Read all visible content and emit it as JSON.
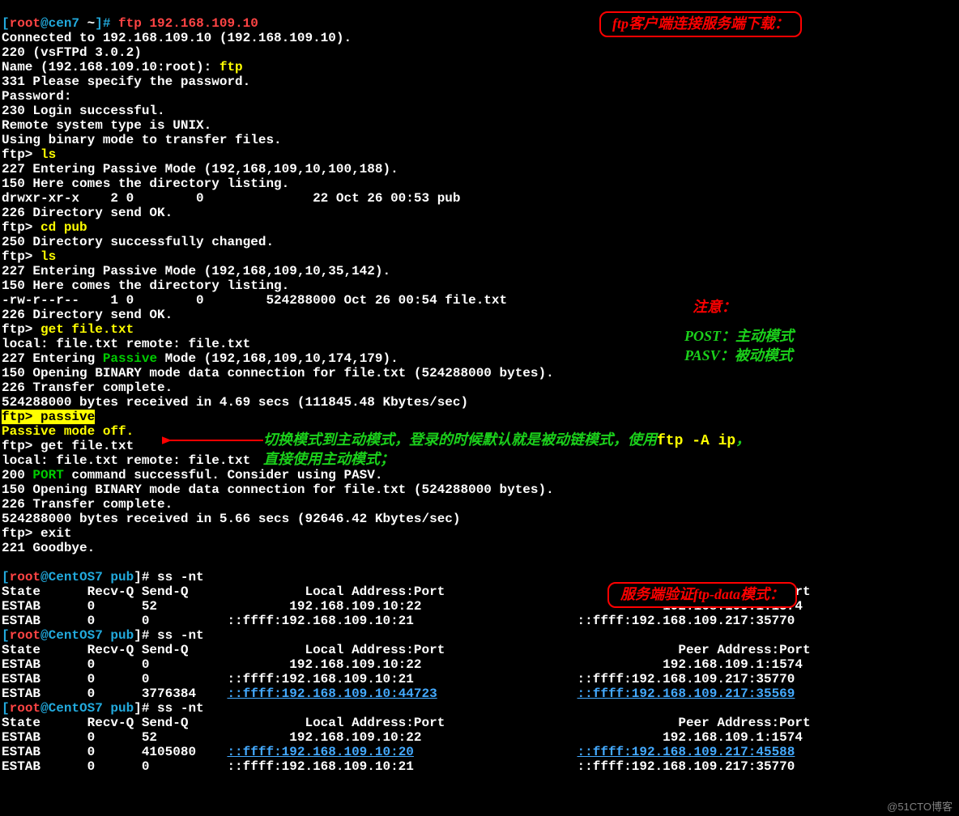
{
  "box1_text": "ftp客户端连接服务端下载：",
  "box2_text": "服务端验证ftp-data模式：",
  "warn_label": "注意：",
  "post_label": "POST：",
  "post_text": "主动模式",
  "pasv_label": "PASV：",
  "pasv_text": "被动模式",
  "mode_line1a": "切换模式到主动模式，登录的时候默认就是被动链模式，使用",
  "mode_line1b": "ftp -A ip",
  "mode_line1c": "，",
  "mode_line2": "直接使用主动模式；",
  "watermark": "@51CTO博客",
  "t": {
    "p1a": "[",
    "p1b": "root",
    "p1c": "@cen7 ",
    "p1d": "~",
    "p1e": "]# ",
    "p1f": "ftp 192.168.109.10",
    "l2": "Connected to 192.168.109.10 (192.168.109.10).",
    "l3": "220 (vsFTPd 3.0.2)",
    "l4a": "Name (192.168.109.10:root): ",
    "l4b": "ftp",
    "l5": "331 Please specify the password.",
    "l6": "Password:",
    "l7": "230 Login successful.",
    "l8": "Remote system type is UNIX.",
    "l9": "Using binary mode to transfer files.",
    "l10a": "ftp> ",
    "l10b": "ls",
    "l11": "227 Entering Passive Mode (192,168,109,10,100,188).",
    "l12": "150 Here comes the directory listing.",
    "l13": "drwxr-xr-x    2 0        0              22 Oct 26 00:53 pub",
    "l14": "226 Directory send OK.",
    "l15a": "ftp> ",
    "l15b": "cd pub",
    "l16": "250 Directory successfully changed.",
    "l17a": "ftp> ",
    "l17b": "ls",
    "l18": "227 Entering Passive Mode (192,168,109,10,35,142).",
    "l19": "150 Here comes the directory listing.",
    "l20": "-rw-r--r--    1 0        0        524288000 Oct 26 00:54 file.txt",
    "l21": "226 Directory send OK.",
    "l22a": "ftp> ",
    "l22b": "get file.txt",
    "l23": "local: file.txt remote: file.txt",
    "l24a": "227 Entering ",
    "l24b": "Passive",
    "l24c": " Mode (192,168,109,10,174,179).",
    "l25": "150 Opening BINARY mode data connection for file.txt (524288000 bytes).",
    "l26": "226 Transfer complete.",
    "l27": "524288000 bytes received in 4.69 secs (111845.48 Kbytes/sec)",
    "l28a": "ftp> ",
    "l28b": "passive",
    "l29": "Passive mode off.",
    "l30": "ftp> get file.txt",
    "l31": "local: file.txt remote: file.txt",
    "l32a": "200 ",
    "l32b": "PORT",
    "l32c": " command successful. Consider using PASV.",
    "l33": "150 Opening BINARY mode data connection for file.txt (524288000 bytes).",
    "l34": "226 Transfer complete.",
    "l35": "524288000 bytes received in 5.66 secs (92646.42 Kbytes/sec)",
    "l36": "ftp> exit",
    "l37": "221 Goodbye.",
    "blank": "",
    "p2a": "[",
    "p2b": "root",
    "p2c": "@CentOS7 pub",
    "p2d": "]# ss -nt",
    "hdr": "State      Recv-Q Send-Q               Local Address:Port                              Peer Address:Port",
    "r1": "ESTAB      0      52                 192.168.109.10:22                               192.168.109.1:1574",
    "r2": "ESTAB      0      0          ::ffff:192.168.109.10:21                     ::ffff:192.168.109.217:35770",
    "r3": "ESTAB      0      0                  192.168.109.10:22                               192.168.109.1:1574",
    "r4": "ESTAB      0      0          ::ffff:192.168.109.10:21                     ::ffff:192.168.109.217:35770",
    "r5a": "ESTAB      0      3776384    ",
    "r5b": "::ffff:192.168.109.10:44723",
    "r5c": "                  ",
    "r5d": "::ffff:192.168.109.217:35569",
    "r6": "ESTAB      0      52                 192.168.109.10:22                               192.168.109.1:1574",
    "r7a": "ESTAB      0      4105080    ",
    "r7b": "::ffff:192.168.109.10:20",
    "r7c": "                     ",
    "r7d": "::ffff:192.168.109.217:45588",
    "r8": "ESTAB      0      0          ::ffff:192.168.109.10:21                     ::ffff:192.168.109.217:35770"
  }
}
